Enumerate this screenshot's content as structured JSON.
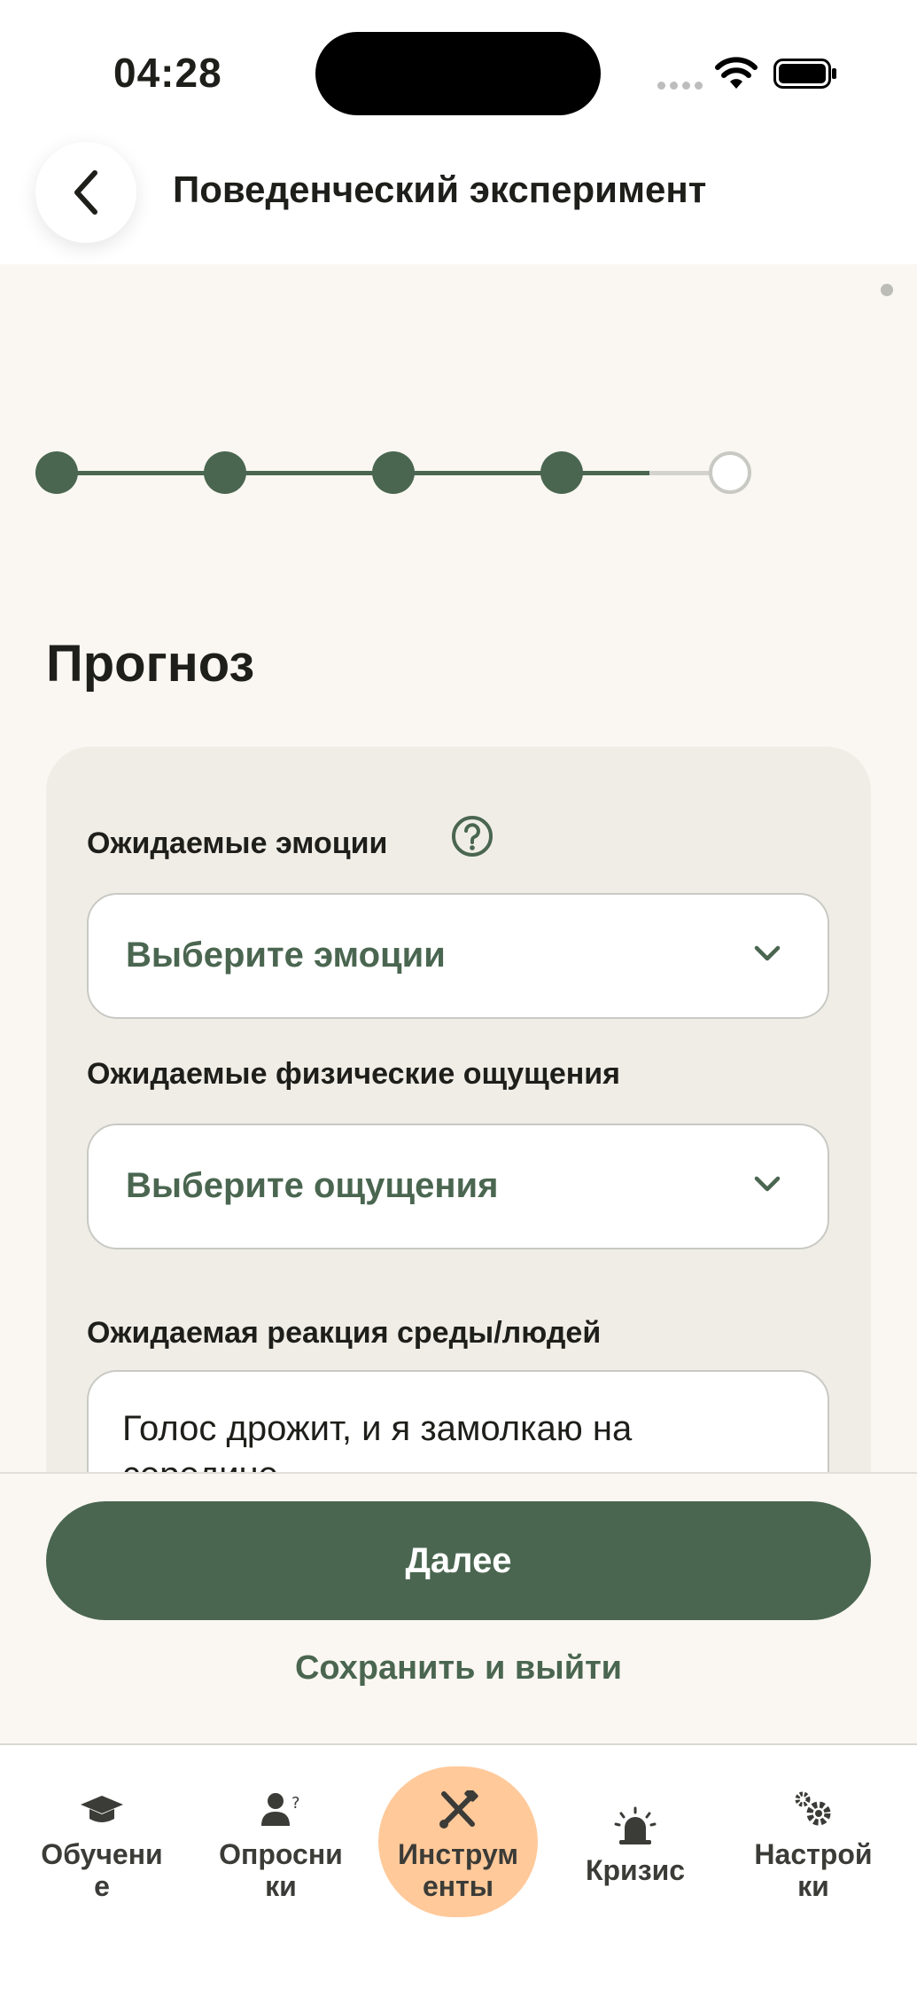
{
  "status_bar": {
    "time": "04:28"
  },
  "header": {
    "title": "Поведенческий эксперимент"
  },
  "stepper": {
    "total_steps": 5,
    "completed_steps": 4,
    "current_step": 5
  },
  "section": {
    "title": "Прогноз"
  },
  "form": {
    "emotions": {
      "label": "Ожидаемые эмоции",
      "placeholder": "Выберите эмоции"
    },
    "sensations": {
      "label": "Ожидаемые физические ощущения",
      "placeholder": "Выберите ощущения"
    },
    "reaction": {
      "label": "Ожидаемая реакция среды/людей",
      "value": "Голос дрожит, и я замолкаю на середине"
    }
  },
  "footer": {
    "next_label": "Далее",
    "save_exit_label": "Сохранить и выйти"
  },
  "tabbar": {
    "items": [
      {
        "label": "Обучение",
        "icon": "graduation-cap-icon",
        "active": false
      },
      {
        "label": "Опросники",
        "icon": "user-question-icon",
        "active": false
      },
      {
        "label": "Инструменты",
        "icon": "tools-icon",
        "active": true
      },
      {
        "label": "Кризис",
        "icon": "siren-icon",
        "active": false
      },
      {
        "label": "Настройки",
        "icon": "gear-icon",
        "active": false
      }
    ]
  },
  "colors": {
    "accent": "#4A6650",
    "active_tab": "#FFC99A",
    "background": "#FAF7F2",
    "card": "#F0EDE7"
  }
}
